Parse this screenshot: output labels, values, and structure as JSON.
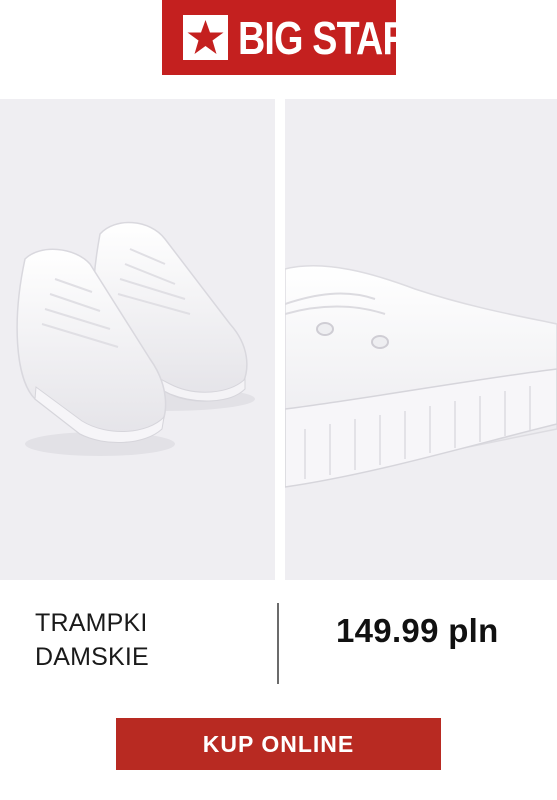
{
  "brand": {
    "name": "BIG STAR",
    "logo_bg": "#c4201f",
    "star_color": "#c4201f",
    "icon": "star-icon"
  },
  "gallery": [
    {
      "icon": "sneakers-pair-image"
    },
    {
      "icon": "sneaker-toe-closeup-image"
    }
  ],
  "product": {
    "name_line1": "TRAMPKI",
    "name_line2": "DAMSKIE",
    "price": "149.99 pln"
  },
  "cta": {
    "label": "KUP ONLINE",
    "color": "#b82a22"
  },
  "colors": {
    "photo_bg": "#efeef2",
    "divider": "#6b6b6b"
  }
}
